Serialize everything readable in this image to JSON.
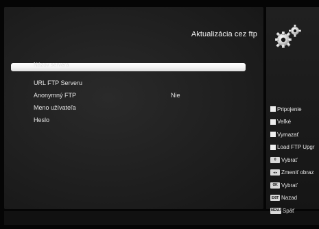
{
  "header": {
    "title": "Aktualizácia cez ftp",
    "icon": "gears-icon"
  },
  "menu": {
    "items": [
      {
        "label": "Názov servera",
        "value": "",
        "selected": true
      },
      {
        "label": "URL FTP Serveru",
        "value": ""
      },
      {
        "label": "Anonymný FTP",
        "value": "Nie"
      },
      {
        "label": "Meno užívateľa",
        "value": ""
      },
      {
        "label": "Heslo",
        "value": ""
      }
    ]
  },
  "legend": {
    "items": [
      {
        "icon": "red-square-icon",
        "key": "",
        "label": "Pripojenie"
      },
      {
        "icon": "green-square-icon",
        "key": "",
        "label": "Veľké"
      },
      {
        "icon": "yellow-square-icon",
        "key": "",
        "label": "Vymazať"
      },
      {
        "icon": "blue-square-icon",
        "key": "",
        "label": "Load FTP Upgr"
      },
      {
        "icon": "key-button-icon",
        "key": "0",
        "label": "Vybrať"
      },
      {
        "icon": "key-button-icon",
        "key": "◂ ▸",
        "label": "Zmeniť obraz"
      },
      {
        "icon": "key-button-icon",
        "key": "OK",
        "label": "Vybrať"
      },
      {
        "icon": "key-button-icon",
        "key": "EXIT",
        "label": "Nazad"
      },
      {
        "icon": "key-button-icon",
        "key": "MENU",
        "label": "Späť"
      }
    ]
  },
  "colors": {
    "panel": "#1f1f1f",
    "highlight": "#ffffff",
    "text": "#e8e8e8"
  }
}
